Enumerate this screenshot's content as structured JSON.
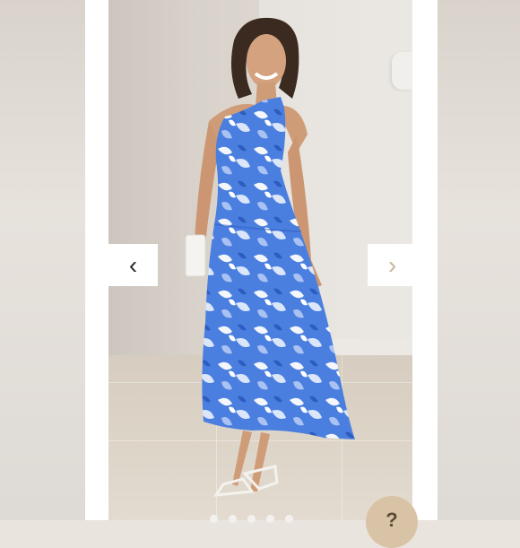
{
  "gallery": {
    "prev_icon_glyph": "‹",
    "next_icon_glyph": "›",
    "slide_count": 5,
    "help_glyph": "?"
  },
  "colors": {
    "dress_blue": "#3b6fd4",
    "dress_white": "#f4f6fb",
    "accent_tan": "#d9c3a6"
  },
  "icons": [
    "chevron-left-icon",
    "chevron-right-icon",
    "help-icon"
  ]
}
